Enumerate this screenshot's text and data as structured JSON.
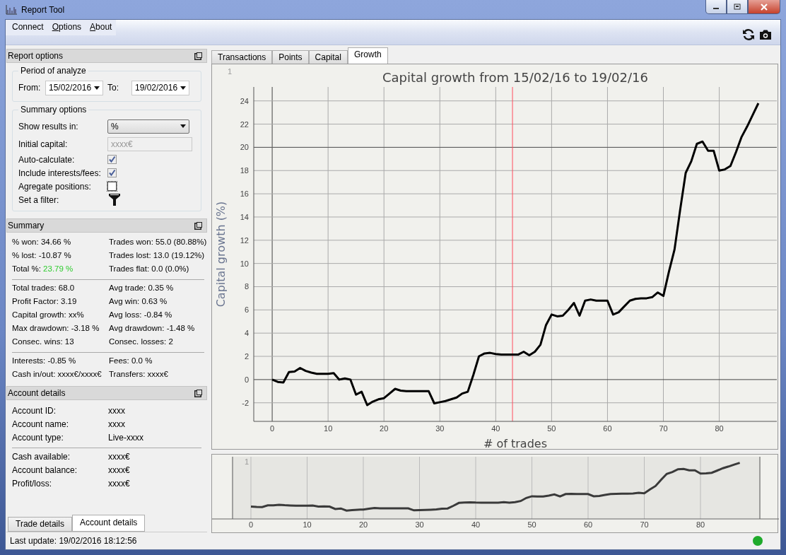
{
  "window": {
    "title": "Report Tool"
  },
  "menu": [
    {
      "label": "Connect",
      "mnemonic": false
    },
    {
      "label": "Options",
      "mnemonic": true
    },
    {
      "label": "About",
      "mnemonic": true
    }
  ],
  "report_options": {
    "title": "Report options",
    "period": {
      "title": "Period of analyze",
      "from_label": "From:",
      "from": "15/02/2016",
      "to_label": "To:",
      "to": "19/02/2016"
    },
    "summary_options": {
      "title": "Summary options",
      "rows": [
        {
          "kind": "select",
          "label": "Show results in:",
          "value": "%"
        },
        {
          "kind": "input",
          "label": "Initial capital:",
          "value": "xxxx€",
          "disabled": true
        },
        {
          "kind": "checkbox",
          "label": "Auto-calculate:",
          "checked": true,
          "disabled": true
        },
        {
          "kind": "checkbox",
          "label": "Include interests/fees:",
          "checked": true,
          "disabled": true
        },
        {
          "kind": "checkbox",
          "label": "Agregate positions:",
          "checked": false,
          "disabled": false
        },
        {
          "kind": "filter",
          "label": "Set a filter:"
        }
      ]
    }
  },
  "summary": {
    "title": "Summary",
    "groups": [
      [
        [
          {
            "label": "% won:",
            "value": "34.66 %",
            "positive": false
          },
          {
            "label": "Trades won:",
            "value": "55.0 (80.88%)",
            "positive": false
          }
        ],
        [
          {
            "label": "% lost:",
            "value": "-10.87 %",
            "positive": false
          },
          {
            "label": "Trades lost:",
            "value": "13.0 (19.12%)",
            "positive": false
          }
        ],
        [
          {
            "label": "Total %:",
            "value": "23.79 %",
            "positive": true
          },
          {
            "label": "Trades flat:",
            "value": "0.0 (0.0%)",
            "positive": false
          }
        ]
      ],
      [
        [
          {
            "label": "Total trades:",
            "value": "68.0",
            "positive": false
          },
          {
            "label": "Avg trade:",
            "value": "0.35 %",
            "positive": false
          }
        ],
        [
          {
            "label": "Profit Factor:",
            "value": "3.19",
            "positive": false
          },
          {
            "label": "Avg win:",
            "value": "0.63 %",
            "positive": false
          }
        ],
        [
          {
            "label": "Capital growth:",
            "value": "xx%",
            "positive": false
          },
          {
            "label": "Avg loss:",
            "value": "-0.84 %",
            "positive": false
          }
        ],
        [
          {
            "label": "Max drawdown:",
            "value": "-3.18 %",
            "positive": false
          },
          {
            "label": "Avg drawdown:",
            "value": "-1.48 %",
            "positive": false
          }
        ],
        [
          {
            "label": "Consec. wins:",
            "value": "13",
            "positive": false
          },
          {
            "label": "Consec. losses:",
            "value": "2",
            "positive": false
          }
        ]
      ],
      [
        [
          {
            "label": "Interests:",
            "value": "-0.85 %",
            "positive": false
          },
          {
            "label": "Fees:",
            "value": "0.0 %",
            "positive": false
          }
        ],
        [
          {
            "label": "Cash in/out:",
            "value": "xxxx€/xxxx€",
            "positive": false
          },
          {
            "label": "Transfers:",
            "value": "xxxx€",
            "positive": false
          }
        ]
      ]
    ]
  },
  "account_details": {
    "title": "Account details",
    "groups": [
      [
        {
          "label": "Account ID:",
          "value": "xxxx"
        },
        {
          "label": "Account name:",
          "value": "xxxx"
        },
        {
          "label": "Account type:",
          "value": "Live-xxxx"
        }
      ],
      [
        {
          "label": "Cash available:",
          "value": "xxxx€"
        },
        {
          "label": "Account balance:",
          "value": "xxxx€"
        },
        {
          "label": "Profit/loss:",
          "value": "xxxx€"
        }
      ]
    ]
  },
  "left_tabs": [
    {
      "label": "Trade details",
      "selected": false
    },
    {
      "label": "Account details",
      "selected": true
    }
  ],
  "tabs": [
    {
      "label": "Transactions",
      "selected": false
    },
    {
      "label": "Points",
      "selected": false
    },
    {
      "label": "Capital",
      "selected": false
    },
    {
      "label": "Growth",
      "selected": true
    }
  ],
  "chart": {
    "corner_label": "1",
    "chart_data": {
      "type": "line",
      "title": "Capital growth from 15/02/16 to 19/02/16",
      "xlabel": "# of trades",
      "ylabel": "Capital growth (%)",
      "x": [
        0,
        1,
        2,
        3,
        4,
        5,
        6,
        7,
        8,
        9,
        10,
        11,
        12,
        13,
        14,
        15,
        16,
        17,
        18,
        19,
        20,
        21,
        22,
        23,
        24,
        25,
        26,
        27,
        28,
        29,
        30,
        31,
        32,
        33,
        34,
        35,
        36,
        37,
        38,
        39,
        40,
        41,
        42,
        43,
        44,
        45,
        46,
        47,
        48,
        49,
        50,
        51,
        52,
        53,
        54,
        55,
        56,
        57,
        58,
        59,
        60,
        61,
        62,
        63,
        64,
        65,
        66,
        67,
        68,
        69,
        70,
        71,
        72,
        73,
        74,
        75,
        76,
        77,
        78,
        79,
        80,
        81,
        82,
        83,
        84,
        85,
        86,
        87
      ],
      "grid": true,
      "series": [
        {
          "color": "#000000",
          "values": [
            0,
            -0.2,
            -0.25,
            0.65,
            0.7,
            1.0,
            0.75,
            0.6,
            0.5,
            0.5,
            0.5,
            0.55,
            0,
            0.1,
            0,
            -1.3,
            -1.05,
            -2.2,
            -1.9,
            -1.7,
            -1.6,
            -1.2,
            -0.8,
            -0.95,
            -1.0,
            -1.0,
            -1.0,
            -1.0,
            -1.0,
            -2.05,
            -1.95,
            -1.85,
            -1.7,
            -1.55,
            -1.2,
            -1.05,
            0.4,
            2.0,
            2.25,
            2.3,
            2.2,
            2.15,
            2.15,
            2.15,
            2.15,
            2.4,
            2.1,
            2.4,
            3.0,
            4.7,
            5.6,
            5.45,
            5.5,
            6.0,
            6.6,
            5.5,
            6.8,
            6.9,
            6.8,
            6.8,
            6.8,
            5.6,
            5.8,
            6.3,
            6.8,
            6.95,
            7.0,
            7.0,
            7.1,
            7.5,
            7.2,
            9.3,
            11.2,
            14.6,
            17.8,
            18.8,
            20.3,
            20.5,
            19.7,
            19.7,
            18.0,
            18.1,
            18.4,
            19.6,
            20.9,
            21.8,
            22.8,
            23.8
          ]
        }
      ],
      "xlim": [
        -3.3,
        90.3
      ],
      "ylim": [
        -3.6,
        25.2
      ],
      "xticks": [
        0,
        10,
        20,
        30,
        40,
        50,
        60,
        70,
        80
      ],
      "yticks": [
        -2,
        0,
        2,
        4,
        6,
        8,
        10,
        12,
        14,
        16,
        18,
        20,
        22,
        24
      ],
      "ref_lines": [
        {
          "axis": "y",
          "value": 20,
          "color": "#555555"
        },
        {
          "axis": "x",
          "value": 43,
          "color": "#ff4d5e"
        }
      ]
    }
  },
  "overview": {
    "corner_label": "1",
    "xticks": [
      "0",
      "10",
      "20",
      "30",
      "40",
      "50",
      "60",
      "70",
      "80"
    ]
  },
  "status_bar": {
    "text": "Last update: 19/02/2016 18:12:56",
    "connected": true
  }
}
